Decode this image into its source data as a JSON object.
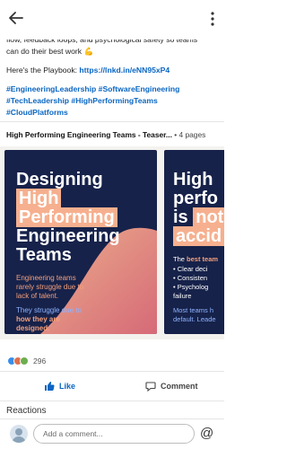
{
  "post": {
    "line1": "flow, feedback loops, and psychological safety so teams",
    "line2": "can do their best work 💪",
    "playbook_prefix": "Here's the Playbook: ",
    "playbook_link": "https://lnkd.in/eNN95xP4",
    "tags_line1": "#EngineeringLeadership #SoftwareEngineering",
    "tags_line2": "#TechLeadership #HighPerformingTeams",
    "tags_line3": "#CloudPlatforms"
  },
  "document": {
    "title": "High Performing Engineering Teams - Teaser...",
    "pages": " • 4 pages"
  },
  "slide1": {
    "h1": "Designing",
    "h2": "High",
    "h3": "Performing",
    "h4": "Engineering",
    "h5": "Teams",
    "sub1_l1": "Engineering teams",
    "sub1_l2": "rarely struggle due to",
    "sub1_l3": "lack of talent.",
    "sub2_l1": "They struggle due to",
    "sub2_l2": "how they are",
    "sub2_l3": "designed."
  },
  "slide2": {
    "h1": "High",
    "h2": "perfo",
    "h3a": "is ",
    "h3b": "not",
    "h4": "accid",
    "intro_a": "The ",
    "intro_b": "best team",
    "li1": "• Clear deci",
    "li2": "• Consisten",
    "li3": "• Psycholog",
    "li3b": "  failure",
    "foot1": "Most teams h",
    "foot2": "default. Leade"
  },
  "reactions": {
    "count": "296",
    "colors": [
      "#378fe9",
      "#df704d",
      "#6dae4f"
    ]
  },
  "actions": {
    "like": "Like",
    "comment": "Comment"
  },
  "reactions_label": "Reactions",
  "comment_box": {
    "placeholder": "Add a comment..."
  },
  "icons": [
    "back-arrow-icon",
    "more-vertical-icon",
    "like-icon",
    "comment-icon",
    "at-mention-icon"
  ]
}
